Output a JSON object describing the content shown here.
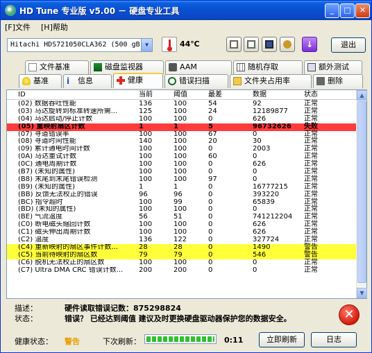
{
  "window": {
    "title": "HD Tune  专业版 v5.00 － 硬盘专业工具"
  },
  "menu": [
    {
      "label": "[F]文件"
    },
    {
      "label": "[H]帮助"
    }
  ],
  "toolbar": {
    "drive": "Hitachi HDS721050CLA362 (500 gB)",
    "temperature": "44℃",
    "exit_label": "退出"
  },
  "tabs_row1": [
    {
      "label": "文件基准"
    },
    {
      "label": "磁盘监视器"
    },
    {
      "label": "AAM"
    },
    {
      "label": "随机存取"
    },
    {
      "label": "额外测试"
    }
  ],
  "tabs_row2": [
    {
      "label": "基准"
    },
    {
      "label": "信息"
    },
    {
      "label": "健康"
    },
    {
      "label": "错误扫描"
    },
    {
      "label": "文件夹占用率"
    },
    {
      "label": "删除"
    }
  ],
  "table": {
    "headers": {
      "id": "ID",
      "current": "当前",
      "threshold": "阈值",
      "worst": "最差",
      "data": "数据",
      "status": "状态"
    },
    "rows": [
      {
        "id": "(02) 数据吞吐性能",
        "current": "136",
        "threshold": "100",
        "worst": "54",
        "data": "92",
        "status": "正常",
        "highlight": "none"
      },
      {
        "id": "(03) 马达旋转到标准转速所需...",
        "current": "125",
        "threshold": "100",
        "worst": "24",
        "data": "12189877",
        "status": "正常",
        "highlight": "none"
      },
      {
        "id": "(04) 马达启动/停止计数",
        "current": "100",
        "threshold": "100",
        "worst": "0",
        "data": "626",
        "status": "正常",
        "highlight": "none"
      },
      {
        "id": "(05) 重映射扇区计数",
        "current": "1",
        "threshold": "1",
        "worst": "5",
        "data": "96732626",
        "status": "失败",
        "highlight": "red"
      },
      {
        "id": "(07) 寻道错误率",
        "current": "100",
        "threshold": "100",
        "worst": "67",
        "data": "0",
        "status": "正常",
        "highlight": "none"
      },
      {
        "id": "(08) 寻道时间性能",
        "current": "140",
        "threshold": "100",
        "worst": "20",
        "data": "30",
        "status": "正常",
        "highlight": "none"
      },
      {
        "id": "(09) 累计通电时间计数",
        "current": "100",
        "threshold": "100",
        "worst": "0",
        "data": "2003",
        "status": "正常",
        "highlight": "none"
      },
      {
        "id": "(0A) 马达重试计数",
        "current": "100",
        "threshold": "100",
        "worst": "60",
        "data": "0",
        "status": "正常",
        "highlight": "none"
      },
      {
        "id": "(0C) 通电周期计数",
        "current": "100",
        "threshold": "100",
        "worst": "0",
        "data": "626",
        "status": "正常",
        "highlight": "none"
      },
      {
        "id": "(B7) (未知的属性)",
        "current": "100",
        "threshold": "100",
        "worst": "0",
        "data": "0",
        "status": "正常",
        "highlight": "none"
      },
      {
        "id": "(B8) 末尾到末尾错误检测",
        "current": "100",
        "threshold": "100",
        "worst": "97",
        "data": "0",
        "status": "正常",
        "highlight": "none"
      },
      {
        "id": "(B9) (未知的属性)",
        "current": "1",
        "threshold": "1",
        "worst": "0",
        "data": "16777215",
        "status": "正常",
        "highlight": "none"
      },
      {
        "id": "(BB) 反馈无法校正的错误",
        "current": "96",
        "threshold": "96",
        "worst": "0",
        "data": "393220",
        "status": "正常",
        "highlight": "none"
      },
      {
        "id": "(BC) 指令超时",
        "current": "100",
        "threshold": "99",
        "worst": "0",
        "data": "65839",
        "status": "正常",
        "highlight": "none"
      },
      {
        "id": "(BD) (未知的属性)",
        "current": "100",
        "threshold": "100",
        "worst": "0",
        "data": "0",
        "status": "正常",
        "highlight": "none"
      },
      {
        "id": "(BE) 气流温度",
        "current": "56",
        "threshold": "51",
        "worst": "0",
        "data": "741212204",
        "status": "正常",
        "highlight": "none"
      },
      {
        "id": "(C0) 断电磁头缩回计数",
        "current": "100",
        "threshold": "100",
        "worst": "0",
        "data": "626",
        "status": "正常",
        "highlight": "none"
      },
      {
        "id": "(C1) 磁头伸出周期计数",
        "current": "100",
        "threshold": "100",
        "worst": "0",
        "data": "626",
        "status": "正常",
        "highlight": "none"
      },
      {
        "id": "(C2) 温度",
        "current": "136",
        "threshold": "122",
        "worst": "0",
        "data": "327724",
        "status": "正常",
        "highlight": "none"
      },
      {
        "id": "(C4) 重新映射的扇区事件计数...",
        "current": "28",
        "threshold": "28",
        "worst": "0",
        "data": "1490",
        "status": "警告",
        "highlight": "yellow"
      },
      {
        "id": "(C5) 当前待映射的扇区数",
        "current": "79",
        "threshold": "79",
        "worst": "0",
        "data": "546",
        "status": "警告",
        "highlight": "yellow"
      },
      {
        "id": "(C6) 脱机无法校正的扇区数",
        "current": "100",
        "threshold": "100",
        "worst": "0",
        "data": "0",
        "status": "正常",
        "highlight": "none"
      },
      {
        "id": "(C7) Ultra DMA CRC 错误计数...",
        "current": "200",
        "threshold": "200",
        "worst": "0",
        "data": "0",
        "status": "正常",
        "highlight": "none"
      }
    ]
  },
  "status": {
    "desc_label": "描述：",
    "desc_value": "硬件读取错误记数：875298824",
    "state_label": "状态：",
    "state_value": "错误？  已经达到阈值 建议及时更换硬盘驱动器保护您的数据安全。"
  },
  "bottom": {
    "health_label": "健康状态：",
    "health_value": "警告",
    "refresh_label": "下次刷新：",
    "refresh_progress": 1.0,
    "timer": "0:11",
    "refresh_button": "立即刷新",
    "log_button": "日志"
  },
  "colors": {
    "fail_row": "#ff3b3b",
    "warn_row": "#ffff3a",
    "warn_text": "#e8a000",
    "progress": "#2fc12f"
  }
}
